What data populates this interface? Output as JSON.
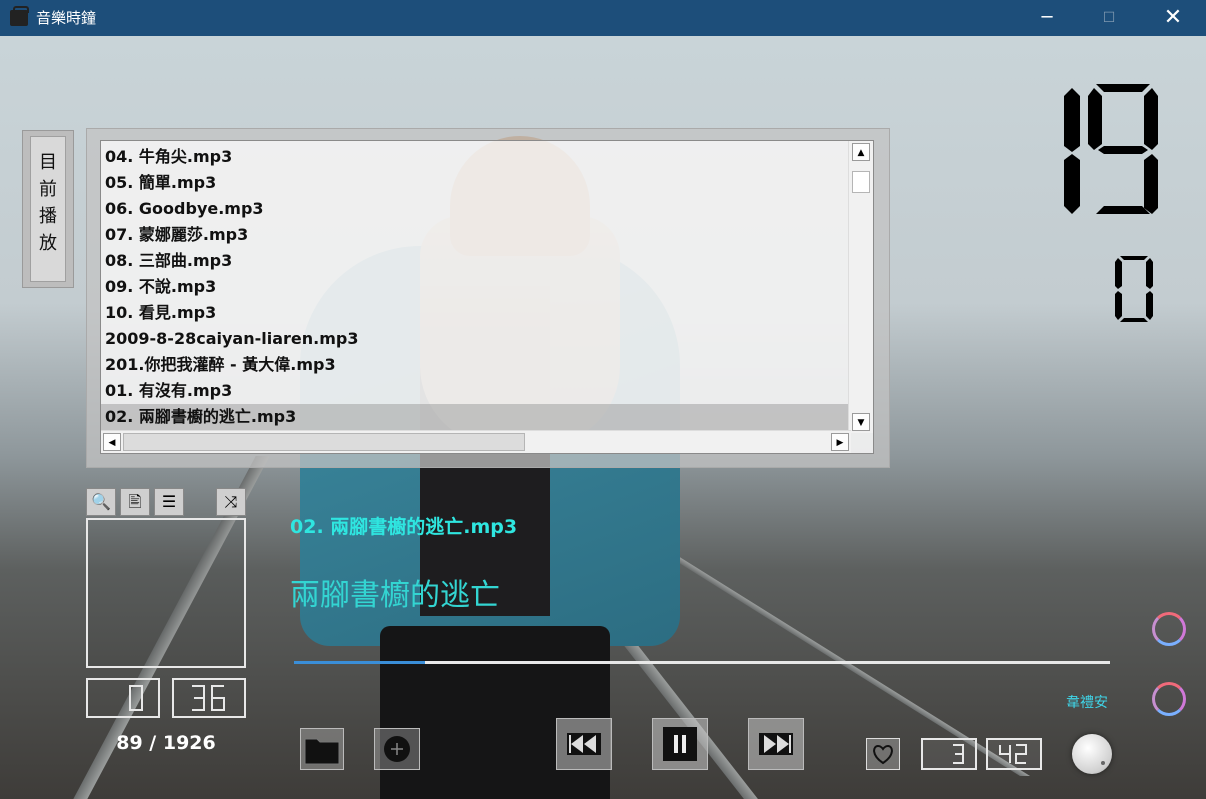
{
  "window": {
    "title": "音樂時鐘",
    "controls": {
      "minimize": "─",
      "maximize": "☐",
      "close": "✕"
    }
  },
  "side_label": [
    "目",
    "前",
    "播",
    "放"
  ],
  "playlist": {
    "items": [
      "04. 牛角尖.mp3",
      "05. 簡單.mp3",
      "06. Goodbye.mp3",
      "07. 蒙娜麗莎.mp3",
      "08. 三部曲.mp3",
      "09. 不說.mp3",
      "10. 看見.mp3",
      "2009-8-28caiyan-liaren.mp3",
      "201.你把我灌醉 - 黃大偉.mp3",
      "01. 有沒有.mp3",
      "02. 兩腳書櫥的逃亡.mp3"
    ],
    "selected_index": 10,
    "scroll_up": "▲",
    "scroll_down": "▼",
    "scroll_left": "◀",
    "scroll_right": "▶"
  },
  "clock": {
    "hour": "19",
    "minute": "0"
  },
  "tools": {
    "search_icon": "🔍",
    "lyrics_icon": "🖹",
    "list_icon": "☰",
    "shuffle_icon": "⤨"
  },
  "elapsed": {
    "minutes": "0",
    "seconds": "36"
  },
  "counter": "89 / 1926",
  "now_playing": {
    "file": "02. 兩腳書櫥的逃亡.mp3",
    "title": "兩腳書櫥的逃亡",
    "progress": 0.16
  },
  "artist": "韋禮安",
  "duration": {
    "minutes": "3",
    "seconds": "42"
  },
  "colors": {
    "accent": "#33d5d2",
    "progress": "#3a8ed8",
    "titlebar": "#1d4e7a"
  }
}
